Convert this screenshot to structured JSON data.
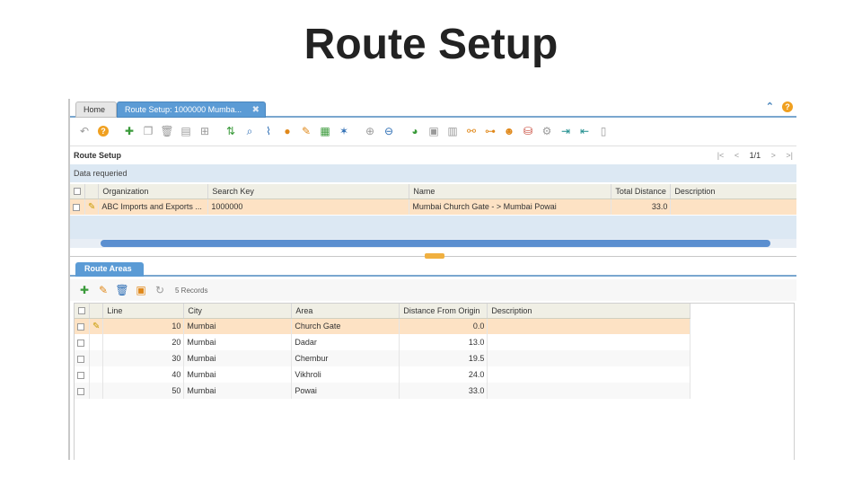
{
  "slide": {
    "title": "Route Setup"
  },
  "tabs": {
    "home": "Home",
    "active": "Route Setup: 1000000 Mumba...",
    "close": "✖"
  },
  "topbar": {
    "collapse_icon": "⌃",
    "help_icon": "?"
  },
  "panel": {
    "title": "Route Setup",
    "status": "Data requeried",
    "pager_count": "1/1"
  },
  "grid": {
    "columns": [
      "Organization",
      "Search Key",
      "Name",
      "Total Distance",
      "Description"
    ],
    "rows": [
      {
        "organization": "ABC Imports and Exports ...",
        "search_key": "1000000",
        "name": "Mumbai Church Gate - > Mumbai Powai",
        "total_distance": "33.0",
        "description": ""
      }
    ]
  },
  "route_areas": {
    "tab": "Route Areas",
    "records": "5 Records",
    "columns": [
      "Line",
      "City",
      "Area",
      "Distance From Origin",
      "Description"
    ],
    "rows": [
      {
        "line": "10",
        "city": "Mumbai",
        "area": "Church Gate",
        "distance": "0.0",
        "description": ""
      },
      {
        "line": "20",
        "city": "Mumbai",
        "area": "Dadar",
        "distance": "13.0",
        "description": ""
      },
      {
        "line": "30",
        "city": "Mumbai",
        "area": "Chembur",
        "distance": "19.5",
        "description": ""
      },
      {
        "line": "40",
        "city": "Mumbai",
        "area": "Vikhroli",
        "distance": "24.0",
        "description": ""
      },
      {
        "line": "50",
        "city": "Mumbai",
        "area": "Powai",
        "distance": "33.0",
        "description": ""
      }
    ]
  },
  "colors": {
    "accent": "#5b9bd5",
    "selected_row": "#fde2c4",
    "header_bg": "#f0efe5"
  }
}
